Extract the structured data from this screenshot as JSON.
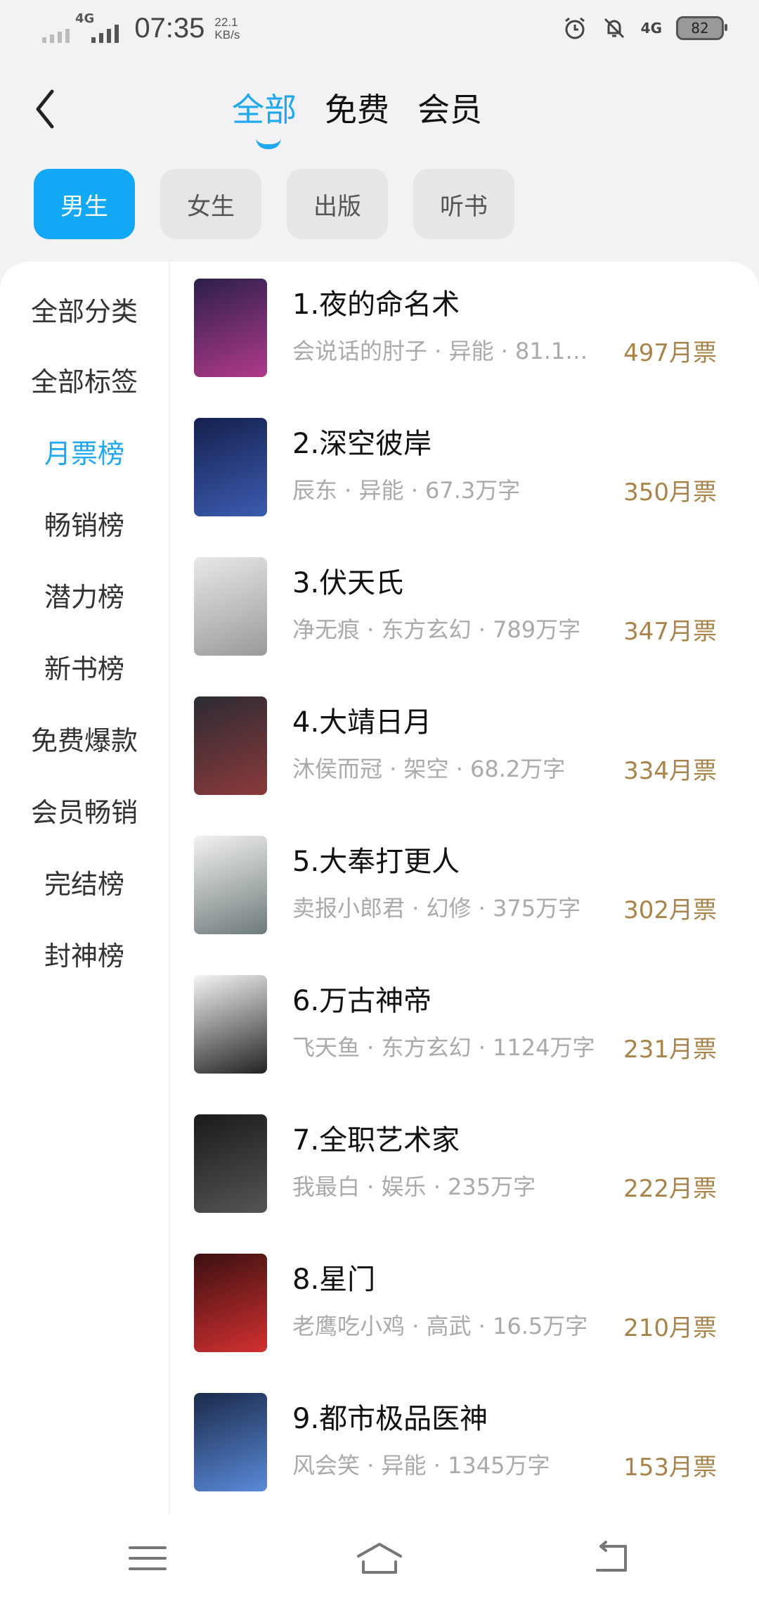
{
  "status_bar": {
    "network_left": "4G",
    "time": "07:35",
    "speed_value": "22.1",
    "speed_unit": "KB/s",
    "network_right": "4G",
    "battery": "82"
  },
  "header": {
    "tabs": [
      {
        "label": "全部",
        "active": true
      },
      {
        "label": "免费",
        "active": false
      },
      {
        "label": "会员",
        "active": false
      }
    ]
  },
  "chips": [
    {
      "label": "男生",
      "active": true
    },
    {
      "label": "女生",
      "active": false
    },
    {
      "label": "出版",
      "active": false
    },
    {
      "label": "听书",
      "active": false
    }
  ],
  "sidebar": {
    "items": [
      {
        "label": "全部分类"
      },
      {
        "label": "全部标签"
      },
      {
        "label": "月票榜",
        "active": true
      },
      {
        "label": "畅销榜"
      },
      {
        "label": "潜力榜"
      },
      {
        "label": "新书榜"
      },
      {
        "label": "免费爆款"
      },
      {
        "label": "会员畅销"
      },
      {
        "label": "完结榜"
      },
      {
        "label": "封神榜"
      }
    ]
  },
  "books": [
    {
      "title": "1.夜的命名术",
      "meta": "会说话的肘子 · 异能 · 81.1…",
      "votes": "497月票",
      "colors": [
        "#2a1f4d",
        "#b03a8a"
      ]
    },
    {
      "title": "2.深空彼岸",
      "meta": "辰东 · 异能 · 67.3万字",
      "votes": "350月票",
      "colors": [
        "#14204d",
        "#3c5cb0"
      ]
    },
    {
      "title": "3.伏天氏",
      "meta": "净无痕 · 东方玄幻 · 789万字",
      "votes": "347月票",
      "colors": [
        "#e8e8e8",
        "#9a9a9a"
      ]
    },
    {
      "title": "4.大靖日月",
      "meta": "沐侯而冠 · 架空 · 68.2万字",
      "votes": "334月票",
      "colors": [
        "#2b2b33",
        "#8a3a3a"
      ]
    },
    {
      "title": "5.大奉打更人",
      "meta": "卖报小郎君 · 幻修 · 375万字",
      "votes": "302月票",
      "colors": [
        "#f2f2f2",
        "#6e7a7a"
      ]
    },
    {
      "title": "6.万古神帝",
      "meta": "飞天鱼 · 东方玄幻 · 1124万字",
      "votes": "231月票",
      "colors": [
        "#f5f5f5",
        "#222222"
      ]
    },
    {
      "title": "7.全职艺术家",
      "meta": "我最白 · 娱乐 · 235万字",
      "votes": "222月票",
      "colors": [
        "#1a1a1a",
        "#555555"
      ]
    },
    {
      "title": "8.星门",
      "meta": "老鹰吃小鸡 · 高武 · 16.5万字",
      "votes": "210月票",
      "colors": [
        "#3a1010",
        "#d23030"
      ]
    },
    {
      "title": "9.都市极品医神",
      "meta": "风会笑 · 异能 · 1345万字",
      "votes": "153月票",
      "colors": [
        "#1a2a4a",
        "#5a8ad8"
      ]
    }
  ],
  "colors": {
    "accent": "#1ea8f0",
    "votes": "#a9844a",
    "meta": "#aaaaaa"
  },
  "navbar": {
    "icons": [
      "menu-icon",
      "home-icon",
      "back-icon"
    ]
  }
}
